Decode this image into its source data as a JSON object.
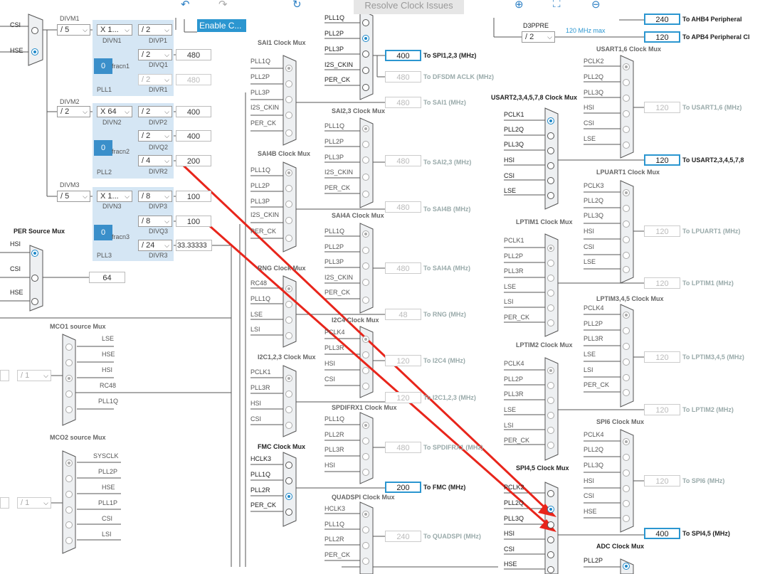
{
  "toolbar": {
    "undo_icon": "undo-icon",
    "redo_icon": "redo-icon",
    "refresh_icon": "refresh-icon",
    "resolve_label": "Resolve Clock Issues",
    "zoom_in_icon": "zoom-in-icon",
    "fit_icon": "fit-screen-icon",
    "zoom_out_icon": "zoom-out-icon"
  },
  "left": {
    "csi": "CSI",
    "hse": "HSE",
    "enable_label": "Enable C...",
    "divm1_label": "DIVM1",
    "divm1_value": "/ 5",
    "divn1_value": "X 1...",
    "divn1_label": "DIVN1",
    "divp1_value": "/ 2",
    "divp1_label": "DIVP1",
    "divq1_value": "/ 2",
    "divq1_label": "DIVQ1",
    "divq1_out": "480",
    "divr1_value": "/ 2",
    "divr1_label": "DIVR1",
    "divr1_out": "480",
    "fracn1_value": "0",
    "fracn1_label": "fracn1",
    "pll1_label": "PLL1",
    "divm2_label": "DIVM2",
    "divm2_value": "/ 2",
    "divn2_value": "X 64",
    "divn2_label": "DIVN2",
    "divp2_value": "/ 2",
    "divp2_label": "DIVP2",
    "divp2_out": "400",
    "divq2_value": "/ 2",
    "divq2_label": "DIVQ2",
    "divq2_out": "400",
    "divr2_value": "/ 4",
    "divr2_label": "DIVR2",
    "divr2_out": "200",
    "fracn2_value": "0",
    "fracn2_label": "fracn2",
    "pll2_label": "PLL2",
    "divm3_label": "DIVM3",
    "divm3_value": "/ 5",
    "divn3_value": "X 1...",
    "divn3_label": "DIVN3",
    "divp3_value": "/ 8",
    "divp3_label": "DIVP3",
    "divp3_out": "100",
    "divq3_value": "/ 8",
    "divq3_label": "DIVQ3",
    "divq3_out": "100",
    "divr3_value": "/ 24",
    "divr3_label": "DIVR3",
    "divr3_out": "33.33333",
    "fracn3_value": "0",
    "fracn3_label": "fracn3",
    "pll3_label": "PLL3",
    "per_title": "PER Source Mux",
    "per_inputs": [
      "HSI",
      "CSI",
      "HSE"
    ],
    "per_out": "64",
    "mco1_title": "MCO1 source Mux",
    "mco1_inputs": [
      "LSE",
      "HSE",
      "HSI",
      "RC48",
      "PLL1Q"
    ],
    "mco1_div": "/ 1",
    "mco2_title": "MCO2 source Mux",
    "mco2_inputs": [
      "SYSCLK",
      "PLL2P",
      "HSE",
      "PLL1P",
      "CSI",
      "LSI"
    ],
    "mco2_div": "/ 1"
  },
  "middle": {
    "top_inputs": [
      "PLL1Q",
      "PLL2P",
      "PLL3P",
      "I2S_CKIN",
      "PER_CK"
    ],
    "spi123_out": "400",
    "spi123_label": "To SPI1,2,3 (MHz)",
    "dfsdm_out": "480",
    "dfsdm_label": "To DFSDM ACLK (MHz)",
    "sai1_title": "SAI1 Clock Mux",
    "sai1_inputs": [
      "PLL1Q",
      "PLL2P",
      "PLL3P",
      "I2S_CKIN",
      "PER_CK"
    ],
    "sai1_out": "480",
    "sai1_label": "To SAI1 (MHz)",
    "sai23_title": "SAI2,3 Clock Mux",
    "sai23_inputs": [
      "PLL1Q",
      "PLL2P",
      "PLL3P",
      "I2S_CKIN",
      "PER_CK"
    ],
    "sai23_out": "480",
    "sai23_label": "To SAI2,3 (MHz)",
    "sai4b_title": "SAI4B Clock Mux",
    "sai4b_inputs": [
      "PLL1Q",
      "PLL2P",
      "PLL3P",
      "I2S_CKIN",
      "PER_CK"
    ],
    "sai4b_out": "480",
    "sai4b_label": "To SAI4B (MHz)",
    "sai4a_title": "SAI4A Clock Mux",
    "sai4a_inputs": [
      "PLL1Q",
      "PLL2P",
      "PLL3P",
      "I2S_CKIN",
      "PER_CK"
    ],
    "sai4a_out": "480",
    "sai4a_label": "To SAI4A (MHz)",
    "rng_title": "RNG Clock Mux",
    "rng_inputs": [
      "RC48",
      "PLL1Q",
      "LSE",
      "LSI"
    ],
    "rng_out": "48",
    "rng_label": "To RNG (MHz)",
    "i2c4_title": "I2C4 Clock Mux",
    "i2c4_inputs": [
      "PCLK4",
      "PLL3R",
      "HSI",
      "CSI"
    ],
    "i2c4_out": "120",
    "i2c4_label": "To I2C4 (MHz)",
    "i2c123_title": "I2C1,2,3 Clock Mux",
    "i2c123_inputs": [
      "PCLK1",
      "PLL3R",
      "HSI",
      "CSI"
    ],
    "i2c123_out": "120",
    "i2c123_label": "To I2C1,2,3 (MHz)",
    "spdif_title": "SPDIFRX1 Clock Mux",
    "spdif_inputs": [
      "PLL1Q",
      "PLL2R",
      "PLL3R",
      "HSI"
    ],
    "spdif_out": "480",
    "spdif_label": "To SPDIFRX1 (MHz)",
    "fmc_title": "FMC Clock Mux",
    "fmc_inputs": [
      "HCLK3",
      "PLL1Q",
      "PLL2R",
      "PER_CK"
    ],
    "fmc_out": "200",
    "fmc_label": "To FMC (MHz)",
    "qspi_title": "QUADSPI Clock Mux",
    "qspi_inputs": [
      "HCLK3",
      "PLL1Q",
      "PLL2R",
      "PER_CK"
    ],
    "qspi_out": "240",
    "qspi_label": "To QUADSPI (MHz)"
  },
  "right": {
    "d3ppre_label": "D3PPRE",
    "d3ppre_value": "/ 2",
    "max_note": "120 MHz max",
    "ahb4_out": "240",
    "ahb4_label": "To AHB4 Peripheral",
    "apb4_out": "120",
    "apb4_label": "To APB4 Peripheral Cl",
    "usart16_title": "USART1,6 Clock Mux",
    "usart16_inputs": [
      "PCLK2",
      "PLL2Q",
      "PLL3Q",
      "HSI",
      "CSI",
      "LSE"
    ],
    "usart16_out": "120",
    "usart16_label": "To USART1,6 (MHz)",
    "usart2_title": "USART2,3,4,5,7,8 Clock Mux",
    "usart2_inputs": [
      "PCLK1",
      "PLL2Q",
      "PLL3Q",
      "HSI",
      "CSI",
      "LSE"
    ],
    "usart2_out": "120",
    "usart2_label": "To USART2,3,4,5,7,8",
    "lpuart_title": "LPUART1 Clock Mux",
    "lpuart_inputs": [
      "PCLK3",
      "PLL2Q",
      "PLL3Q",
      "HSI",
      "CSI",
      "LSE"
    ],
    "lpuart_out": "120",
    "lpuart_label": "To LPUART1 (MHz)",
    "lptim1_title": "LPTIM1 Clock Mux",
    "lptim1_inputs": [
      "PCLK1",
      "PLL2P",
      "PLL3R",
      "LSE",
      "LSI",
      "PER_CK"
    ],
    "lptim1_out": "120",
    "lptim1_label": "To LPTIM1 (MHz)",
    "lptim345_title": "LPTIM3,4,5 Clock Mux",
    "lptim345_inputs": [
      "PCLK4",
      "PLL2P",
      "PLL3R",
      "LSE",
      "LSI",
      "PER_CK"
    ],
    "lptim345_out": "120",
    "lptim345_label": "To LPTIM3,4,5 (MHz)",
    "lptim2_title": "LPTIM2 Clock Mux",
    "lptim2_inputs": [
      "PCLK4",
      "PLL2P",
      "PLL3R",
      "LSE",
      "LSI",
      "PER_CK"
    ],
    "lptim2_out": "120",
    "lptim2_label": "To LPTIM2 (MHz)",
    "spi6_title": "SPI6 Clock Mux",
    "spi6_inputs": [
      "PCLK4",
      "PLL2Q",
      "PLL3Q",
      "HSI",
      "CSI",
      "HSE"
    ],
    "spi6_out": "120",
    "spi6_label": "To SPI6 (MHz)",
    "spi45_title": "SPI4,5 Clock Mux",
    "spi45_inputs": [
      "PCLK2",
      "PLL2Q",
      "PLL3Q",
      "HSI",
      "CSI",
      "HSE"
    ],
    "spi45_out": "400",
    "spi45_label": "To SPI4,5 (MHz)",
    "adc_title": "ADC Clock Mux",
    "adc_inputs": [
      "PLL2P"
    ]
  },
  "colors": {
    "accent": "#2b96d0",
    "pll_bg": "#d5e6f4",
    "arrow": "#e8251b"
  }
}
